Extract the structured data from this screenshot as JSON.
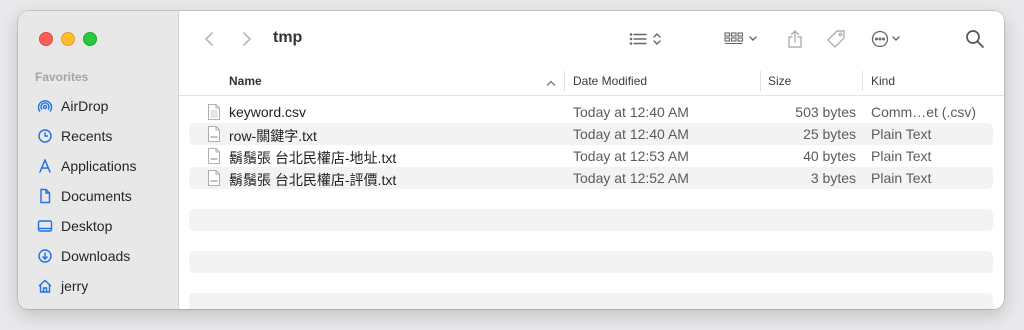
{
  "window": {
    "folder_title": "tmp"
  },
  "sidebar": {
    "section_title": "Favorites",
    "items": [
      {
        "label": "AirDrop",
        "icon": "airdrop-icon"
      },
      {
        "label": "Recents",
        "icon": "clock-icon"
      },
      {
        "label": "Applications",
        "icon": "applications-icon"
      },
      {
        "label": "Documents",
        "icon": "document-icon"
      },
      {
        "label": "Desktop",
        "icon": "desktop-icon"
      },
      {
        "label": "Downloads",
        "icon": "download-icon"
      },
      {
        "label": "jerry",
        "icon": "home-icon"
      }
    ]
  },
  "columns": {
    "name": "Name",
    "date": "Date Modified",
    "size": "Size",
    "kind": "Kind"
  },
  "files": [
    {
      "name": "keyword.csv",
      "date": "Today at 12:40 AM",
      "size": "503 bytes",
      "kind": "Comm…et (.csv)"
    },
    {
      "name": "row-關鍵字.txt",
      "date": "Today at 12:40 AM",
      "size": "25 bytes",
      "kind": "Plain Text"
    },
    {
      "name": "鬍鬚張 台北民權店-地址.txt",
      "date": "Today at 12:53 AM",
      "size": "40 bytes",
      "kind": "Plain Text"
    },
    {
      "name": "鬍鬚張 台北民權店-評價.txt",
      "date": "Today at 12:52 AM",
      "size": "3 bytes",
      "kind": "Plain Text"
    }
  ],
  "colors": {
    "accent": "#1f6fe5",
    "sidebar_bg": "#e8e8e8",
    "alt_row": "#f3f3f3"
  }
}
